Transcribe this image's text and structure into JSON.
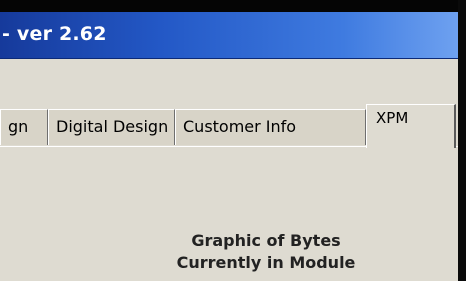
{
  "window": {
    "title": "- ver 2.62"
  },
  "tabs": [
    {
      "label": "gn",
      "active": false
    },
    {
      "label": "Digital Design",
      "active": false
    },
    {
      "label": "Customer Info",
      "active": false
    },
    {
      "label": "XPM",
      "active": true
    }
  ],
  "content": {
    "caption_line1": "Graphic of Bytes",
    "caption_line2": "Currently in Module"
  }
}
